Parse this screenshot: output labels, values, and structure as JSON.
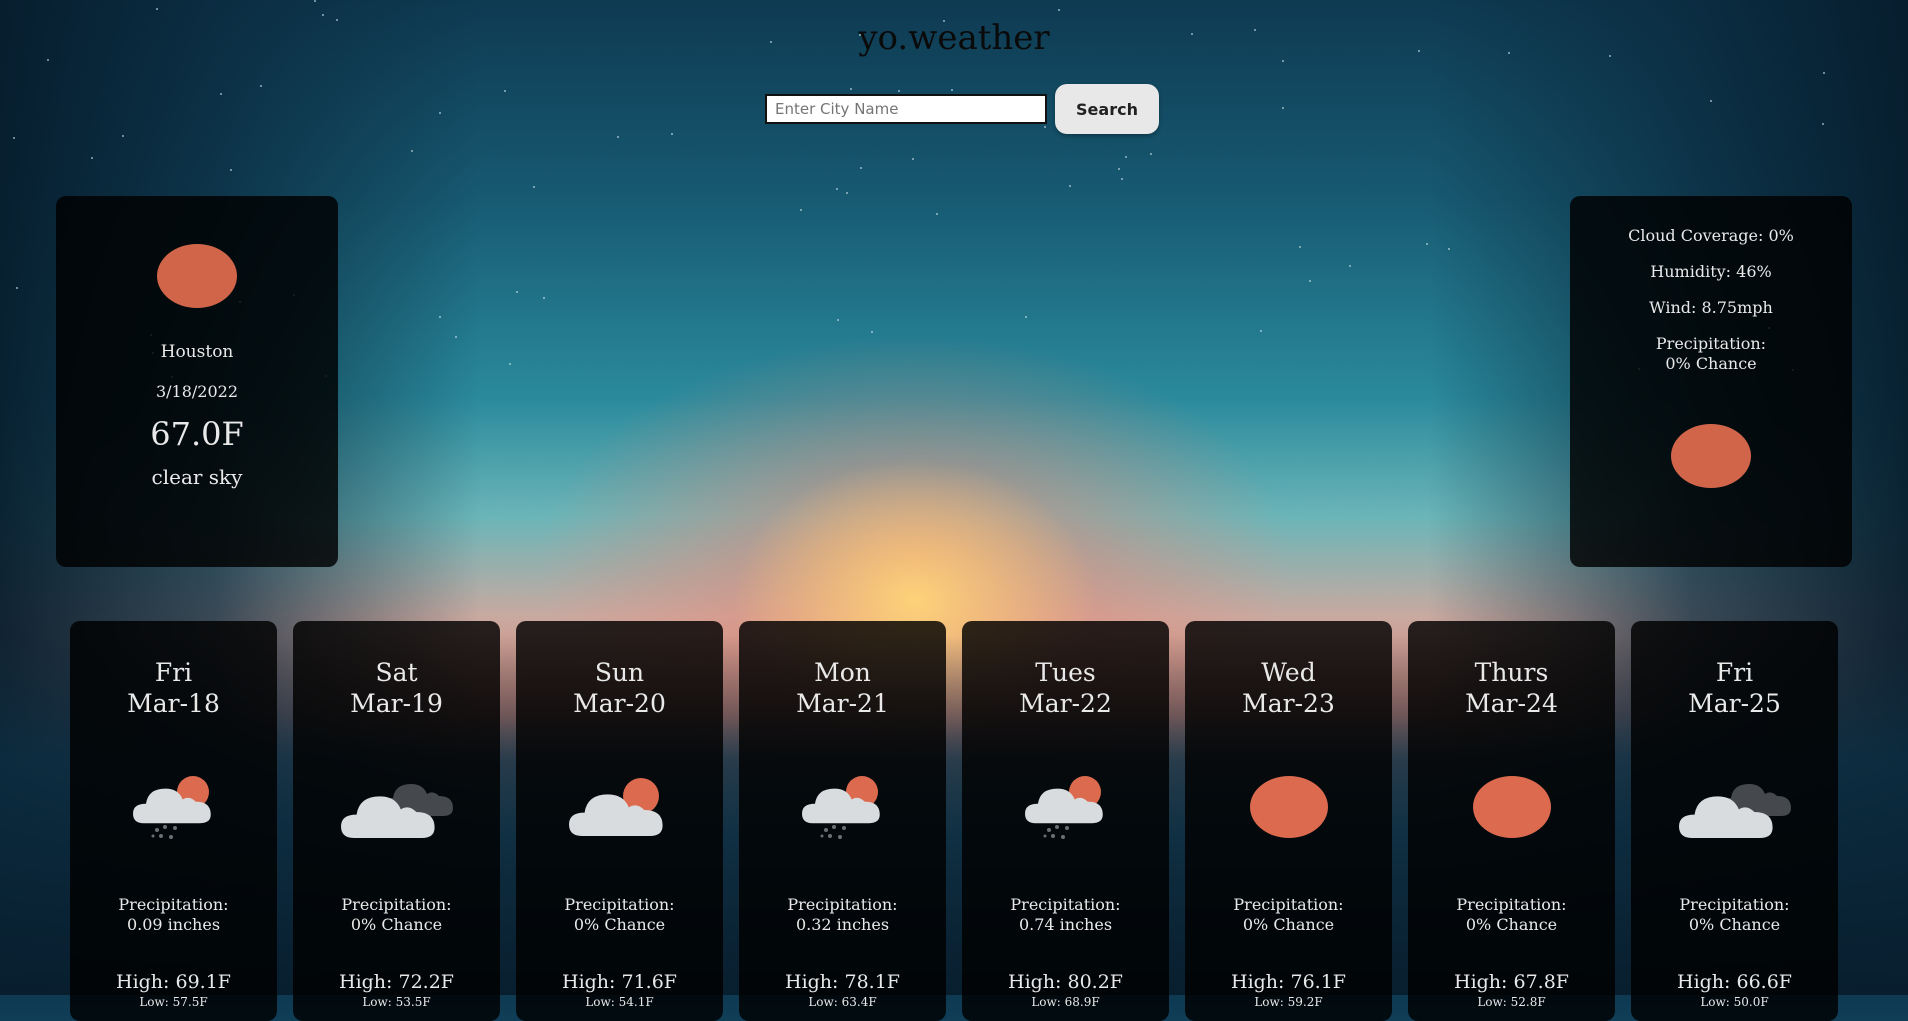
{
  "app": {
    "title": "yo.weather"
  },
  "search": {
    "placeholder": "Enter City Name",
    "value": "",
    "button_label": "Search"
  },
  "current": {
    "icon": "sun-icon",
    "city": "Houston",
    "date": "3/18/2022",
    "temperature": "67.0F",
    "description": "clear sky"
  },
  "details": {
    "cloud_coverage": "Cloud Coverage: 0%",
    "humidity": "Humidity: 46%",
    "wind": "Wind: 8.75mph",
    "precip_label": "Precipitation:",
    "precip_value": "0% Chance",
    "icon": "sun-icon"
  },
  "forecast": [
    {
      "day": "Fri",
      "date": "Mar-18",
      "icon": "rain-cloud-sun-icon",
      "precip_label": "Precipitation:",
      "precip_value": "0.09 inches",
      "high": "High: 69.1F",
      "low": "Low: 57.5F"
    },
    {
      "day": "Sat",
      "date": "Mar-19",
      "icon": "overcast-clouds-icon",
      "precip_label": "Precipitation:",
      "precip_value": "0% Chance",
      "high": "High: 72.2F",
      "low": "Low: 53.5F"
    },
    {
      "day": "Sun",
      "date": "Mar-20",
      "icon": "partly-cloudy-icon",
      "precip_label": "Precipitation:",
      "precip_value": "0% Chance",
      "high": "High: 71.6F",
      "low": "Low: 54.1F"
    },
    {
      "day": "Mon",
      "date": "Mar-21",
      "icon": "rain-cloud-sun-icon",
      "precip_label": "Precipitation:",
      "precip_value": "0.32 inches",
      "high": "High: 78.1F",
      "low": "Low: 63.4F"
    },
    {
      "day": "Tues",
      "date": "Mar-22",
      "icon": "rain-cloud-sun-icon",
      "precip_label": "Precipitation:",
      "precip_value": "0.74 inches",
      "high": "High: 80.2F",
      "low": "Low: 68.9F"
    },
    {
      "day": "Wed",
      "date": "Mar-23",
      "icon": "sun-icon",
      "precip_label": "Precipitation:",
      "precip_value": "0% Chance",
      "high": "High: 76.1F",
      "low": "Low: 59.2F"
    },
    {
      "day": "Thurs",
      "date": "Mar-24",
      "icon": "sun-icon",
      "precip_label": "Precipitation:",
      "precip_value": "0% Chance",
      "high": "High: 67.8F",
      "low": "Low: 52.8F"
    },
    {
      "day": "Fri",
      "date": "Mar-25",
      "icon": "overcast-clouds-icon",
      "precip_label": "Precipitation:",
      "precip_value": "0% Chance",
      "high": "High: 66.6F",
      "low": "Low: 50.0F"
    }
  ],
  "colors": {
    "sun": "#db6a4e",
    "cloud_light": "#d9dcdf",
    "cloud_dark": "#45484c",
    "rain": "#6b6e72",
    "card_bg": "#000000",
    "text": "#e9e9e9"
  }
}
